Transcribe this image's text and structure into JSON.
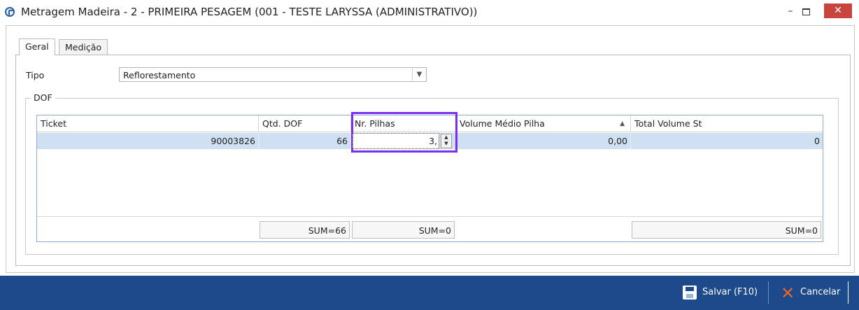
{
  "window": {
    "title": "Metragem Madeira - 2 - PRIMEIRA  PESAGEM (001 - TESTE LARYSSA (ADMINISTRATIVO))",
    "minimize": "–",
    "close": "✕"
  },
  "tabs": [
    {
      "label": "Geral",
      "active": true
    },
    {
      "label": "Medição",
      "active": false
    }
  ],
  "form": {
    "tipo_label": "Tipo",
    "tipo_value": "Reflorestamento",
    "dof_legend": "DOF"
  },
  "grid": {
    "columns": [
      "Ticket",
      "Qtd. DOF",
      "Nr. Pilhas",
      "Volume Médio Pilha",
      "Total Volume St"
    ],
    "rows": [
      {
        "ticket": "90003826",
        "qtd_dof": "66",
        "nr_pilhas": "3,",
        "volume_medio": "0,00",
        "total_volume": "0"
      }
    ],
    "sums": {
      "qtd_dof": "SUM=66",
      "nr_pilhas": "SUM=0",
      "total_volume": "SUM=0"
    },
    "sorted_column": "Volume Médio Pilha"
  },
  "actions": {
    "save": "Salvar (F10)",
    "cancel": "Cancelar"
  },
  "colors": {
    "bottom_bar": "#1c4a8a",
    "selected_row": "#cfe0f3",
    "highlight": "#7a2ff0",
    "close_button": "#c8453d"
  }
}
